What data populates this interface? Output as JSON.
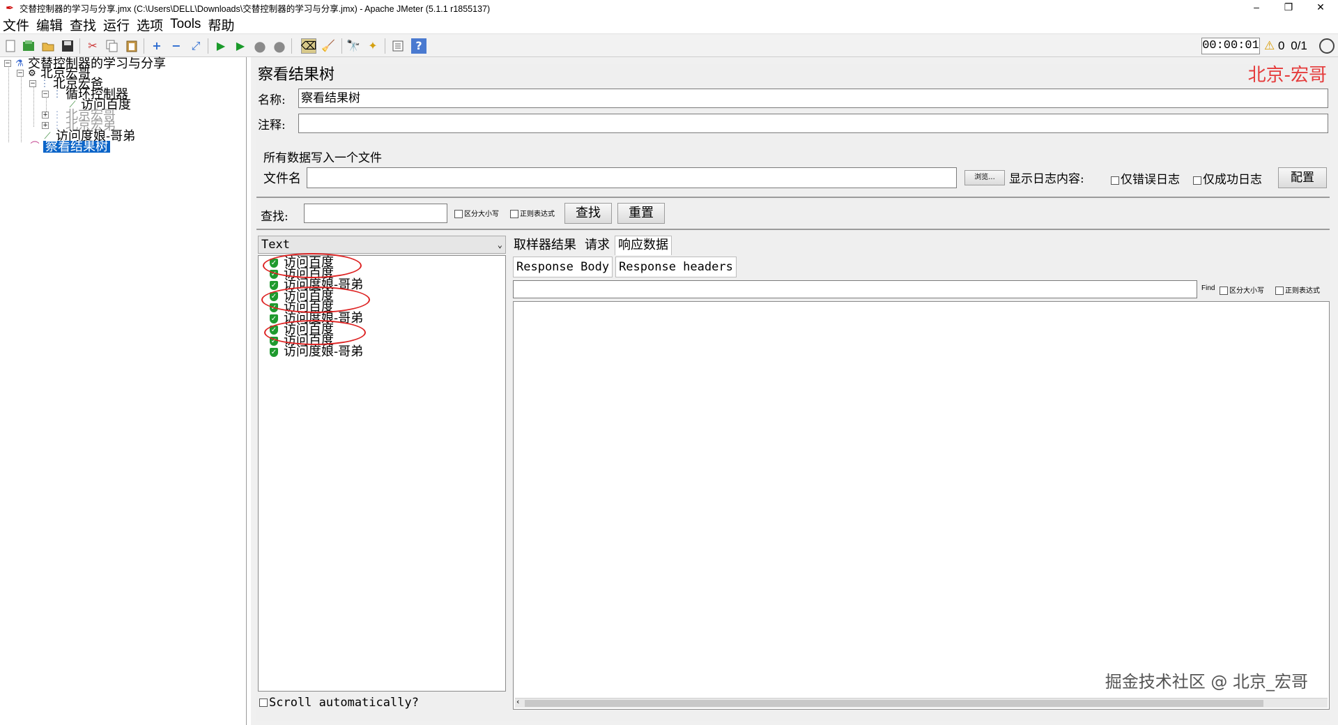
{
  "window": {
    "title": "交替控制器的学习与分享.jmx (C:\\Users\\DELL\\Downloads\\交替控制器的学习与分享.jmx) - Apache JMeter (5.1.1 r1855137)",
    "minimize": "–",
    "restore": "❐",
    "close": "✕"
  },
  "menu": [
    "文件",
    "编辑",
    "查找",
    "运行",
    "选项",
    "Tools",
    "帮助"
  ],
  "toolbar": {
    "timer": "00:00:01",
    "warning_count": "0",
    "threads": "0/1"
  },
  "tree": {
    "root": "交替控制器的学习与分享",
    "items": [
      {
        "label": "北京宏哥"
      },
      {
        "label": "北京宏爸"
      },
      {
        "label": "循环控制器"
      },
      {
        "label": "访问百度"
      },
      {
        "label": "北京宏哥"
      },
      {
        "label": "北京宏弟"
      },
      {
        "label": "访问度娘-哥弟"
      },
      {
        "label": "察看结果树"
      }
    ]
  },
  "panel": {
    "title": "察看结果树",
    "watermark_top": "北京-宏哥",
    "name_label": "名称:",
    "name_value": "察看结果树",
    "comment_label": "注释:",
    "group_title": "所有数据写入一个文件",
    "filename_label": "文件名",
    "browse_btn": "浏览...",
    "log_label": "显示日志内容:",
    "errors_only": "仅错误日志",
    "success_only": "仅成功日志",
    "config_btn": "配置"
  },
  "search": {
    "label": "查找:",
    "case_sensitive": "区分大小写",
    "regex": "正则表达式",
    "find_btn": "查找",
    "reset_btn": "重置"
  },
  "results": {
    "renderer": "Text",
    "samples": [
      "访问百度",
      "访问百度",
      "访问度娘-哥弟",
      "访问百度",
      "访问百度",
      "访问度娘-哥弟",
      "访问百度",
      "访问百度",
      "访问度娘-哥弟"
    ],
    "scroll_auto": "Scroll automatically?"
  },
  "detail": {
    "tabs": [
      "取样器结果",
      "请求",
      "响应数据"
    ],
    "subtabs": [
      "Response Body",
      "Response headers"
    ],
    "find_label": "Find",
    "case_sensitive": "区分大小写",
    "regex": "正则表达式",
    "watermark": "掘金技术社区 @ 北京_宏哥"
  },
  "colors": {
    "accent": "#0a64c8",
    "watermark_red": "#e53b3b",
    "success_green": "#1e9a2e",
    "annotation_red": "#dd2222"
  }
}
